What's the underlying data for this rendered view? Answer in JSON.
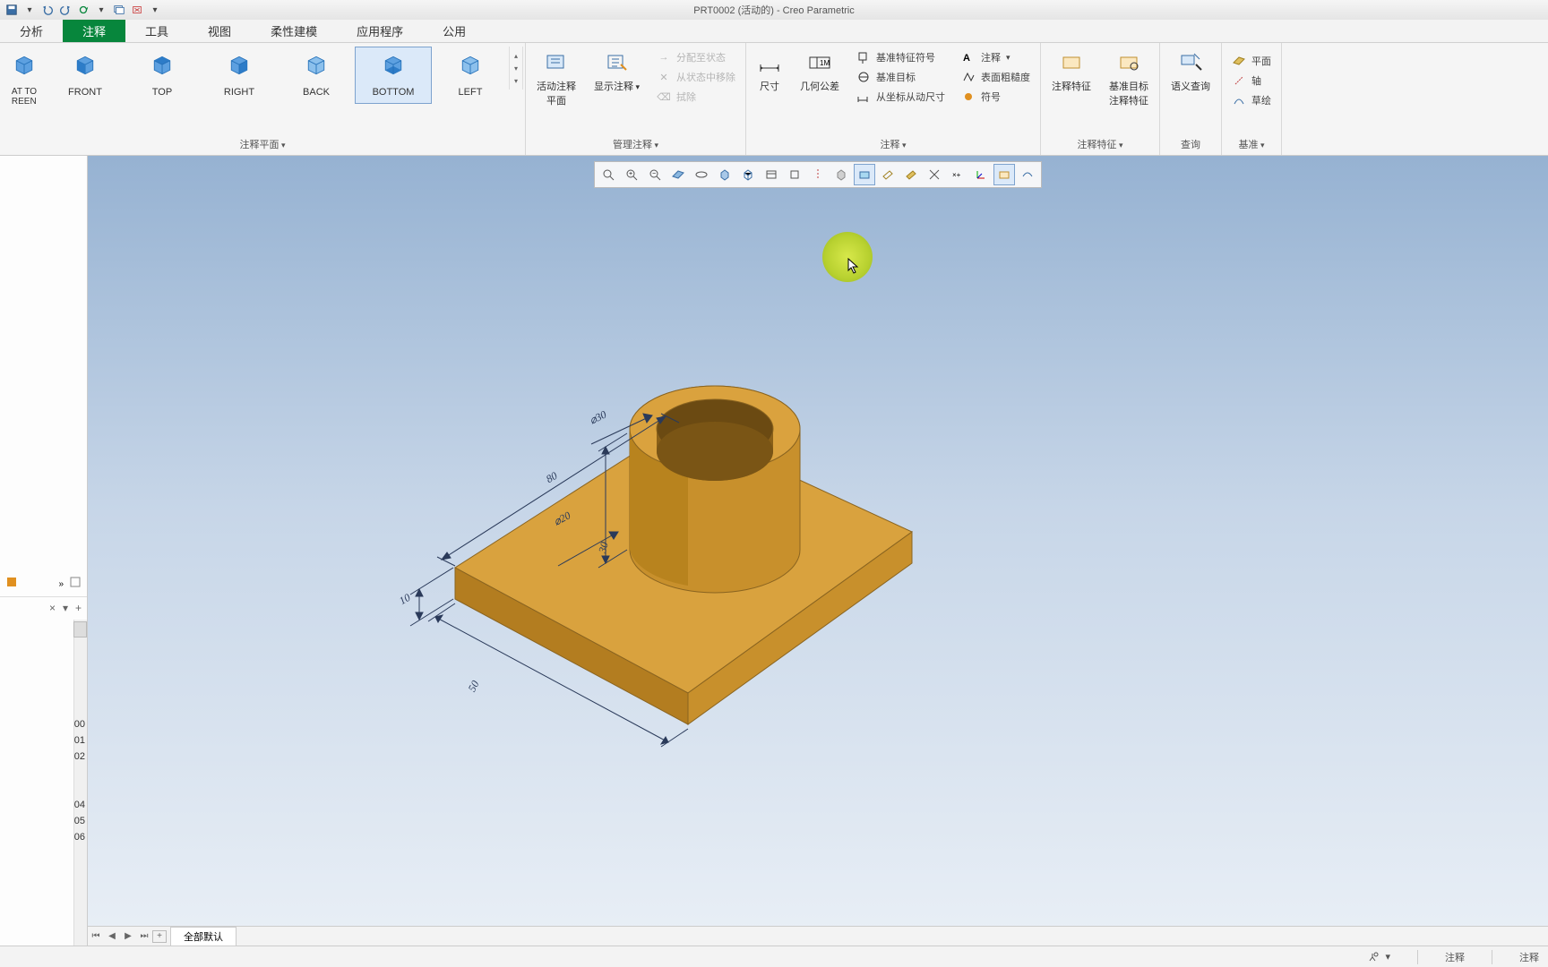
{
  "title": "PRT0002 (活动的) - Creo Parametric",
  "tabs": {
    "t0": "分析",
    "t1": "注释",
    "t2": "工具",
    "t3": "视图",
    "t4": "柔性建模",
    "t5": "应用程序",
    "t6": "公用"
  },
  "views": {
    "v0": "AT TO\nREEN",
    "v1": "FRONT",
    "v2": "TOP",
    "v3": "RIGHT",
    "v4": "BACK",
    "v5": "BOTTOM",
    "v6": "LEFT"
  },
  "groups": {
    "g_views": "注释平面",
    "g_manage": "管理注释",
    "g_annot": "注释",
    "g_feat": "注释特征",
    "g_query": "查询",
    "g_datum": "基准"
  },
  "buttons": {
    "active_plane": "活动注释\n平面",
    "show_annot": "显示注释",
    "assign_state": "分配至状态",
    "remove_state": "从状态中移除",
    "wipe": "拭除",
    "dim": "尺寸",
    "gtol": "几何公差",
    "feat_sym": "基准特征符号",
    "datum_tgt": "基准目标",
    "driven_dim": "从坐标从动尺寸",
    "annot_lbl": "注释",
    "surf_fin": "表面粗糙度",
    "symbol": "符号",
    "annot_feat": "注释特征",
    "datum_tgt_feat": "基准目标\n注释特征",
    "sem_query": "语义查询",
    "plane": "平面",
    "axis": "轴",
    "sketch": "草绘"
  },
  "tree": {
    "i0": "00",
    "i1": "01",
    "i2": "02",
    "i4": "04",
    "i5": "05",
    "i6": "06"
  },
  "bottom_tab": "全部默认",
  "status": {
    "mode": "注释"
  },
  "dims": {
    "d30a": "⌀30",
    "d80": "80",
    "d20": "⌀20",
    "d30b": "30",
    "d10": "10",
    "d50": "50"
  }
}
